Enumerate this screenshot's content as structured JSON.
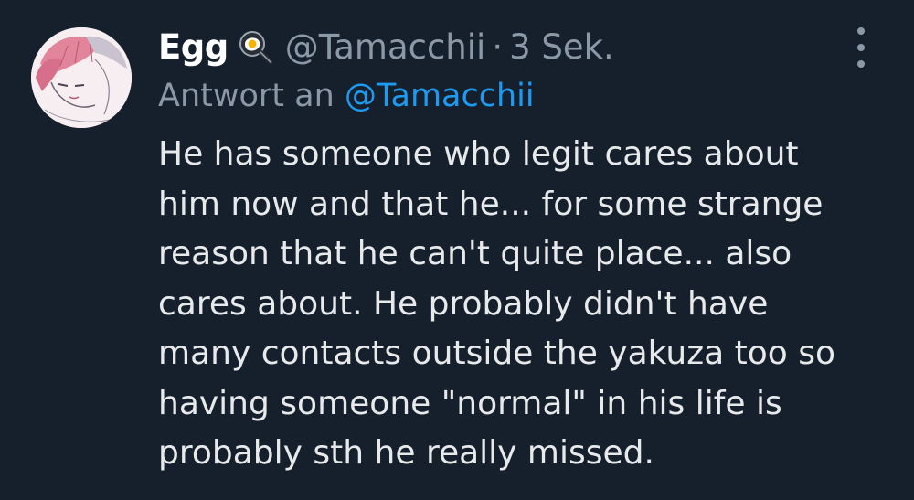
{
  "tweet": {
    "display_name": "Egg",
    "display_name_emoji": "fried-egg-in-pan-icon",
    "handle": "@Tamacchii",
    "separator": "·",
    "timestamp": "3 Sek.",
    "reply_prefix": "Antwort an",
    "reply_to": "@Tamacchii",
    "body_lines": [
      "He has someone who legit cares about",
      "him now and that he... for some strange",
      "reason that he can't quite place... also",
      "cares about. He probably didn't have",
      "many contacts outside the yakuza too so",
      "having someone \"normal\" in his life is",
      "probably sth he really missed."
    ]
  },
  "icons": {
    "more": "more-options-icon",
    "avatar": "avatar"
  },
  "colors": {
    "background": "#16202d",
    "text": "#e7e9ea",
    "muted": "#8b98a5",
    "link": "#1d9bf0"
  }
}
